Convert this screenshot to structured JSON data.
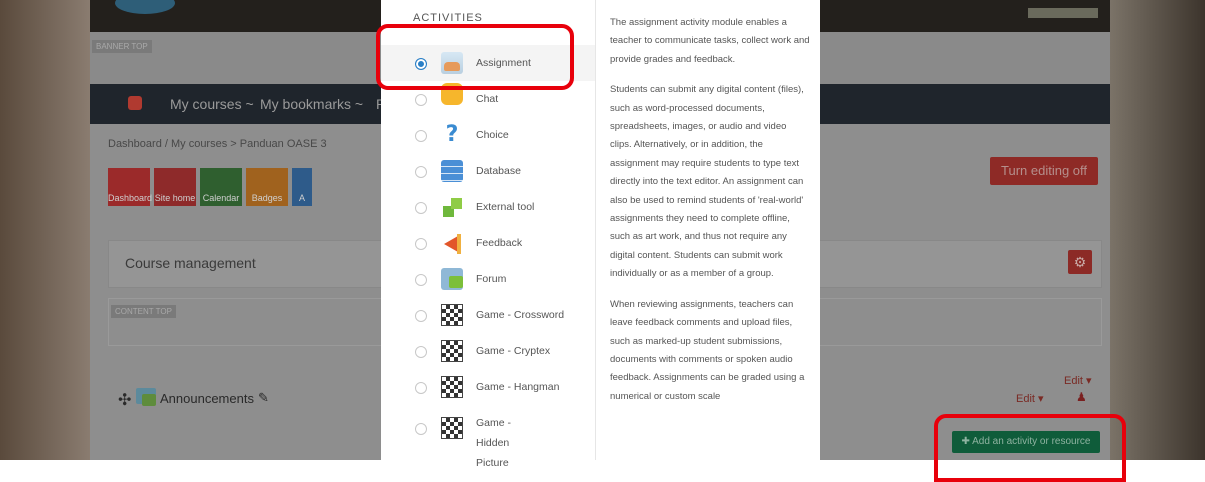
{
  "page": {
    "banner_tag": "BANNER TOP",
    "nav": {
      "my_courses": "My courses ~",
      "my_bookmarks": "My bookmarks ~",
      "more": "P"
    },
    "breadcrumb": "Dashboard  /  My courses  >  Panduan OASE 3",
    "turn_editing_off": "Turn editing off",
    "icon_bar": [
      {
        "label": "Dashboard",
        "color": "#9b2a2a"
      },
      {
        "label": "Site home",
        "color": "#8e2a2a"
      },
      {
        "label": "Calendar",
        "color": "#2f5f2f"
      },
      {
        "label": "Badges",
        "color": "#a0621e"
      },
      {
        "label": "A",
        "color": "#2e5b8a"
      }
    ],
    "course_management": "Course management",
    "content_tag": "CONTENT TOP",
    "announcements": "Announcements",
    "edit_top": "Edit ▾",
    "edit_row": "Edit ▾",
    "add_activity": "✚ Add an activity or resource"
  },
  "modal": {
    "heading": "ACTIVITIES",
    "activities": [
      {
        "label": "Assignment",
        "icon": "assignment-icon",
        "selected": true
      },
      {
        "label": "Chat",
        "icon": "chat-icon"
      },
      {
        "label": "Choice",
        "icon": "choice-icon"
      },
      {
        "label": "Database",
        "icon": "database-icon"
      },
      {
        "label": "External tool",
        "icon": "external-tool-icon"
      },
      {
        "label": "Feedback",
        "icon": "feedback-icon"
      },
      {
        "label": "Forum",
        "icon": "forum-icon"
      },
      {
        "label": "Game - Crossword",
        "icon": "game-icon"
      },
      {
        "label": "Game - Cryptex",
        "icon": "game-icon"
      },
      {
        "label": "Game - Hangman",
        "icon": "game-icon"
      },
      {
        "label": "Game - Hidden Picture",
        "icon": "game-icon"
      }
    ],
    "description": [
      "The assignment activity module enables a teacher to communicate tasks, collect work and provide grades and feedback.",
      "Students can submit any digital content (files), such as word-processed documents, spreadsheets, images, or audio and video clips. Alternatively, or in addition, the assignment may require students to type text directly into the text editor. An assignment can also be used to remind students of 'real-world' assignments they need to complete offline, such as art work, and thus not require any digital content. Students can submit work individually or as a member of a group.",
      "When reviewing assignments, teachers can leave feedback comments and upload files, such as marked-up student submissions, documents with comments or spoken audio feedback. Assignments can be graded using a numerical or custom scale"
    ]
  },
  "colors": {
    "highlight": "#e8000b",
    "selected_radio": "#2a7fc6"
  }
}
